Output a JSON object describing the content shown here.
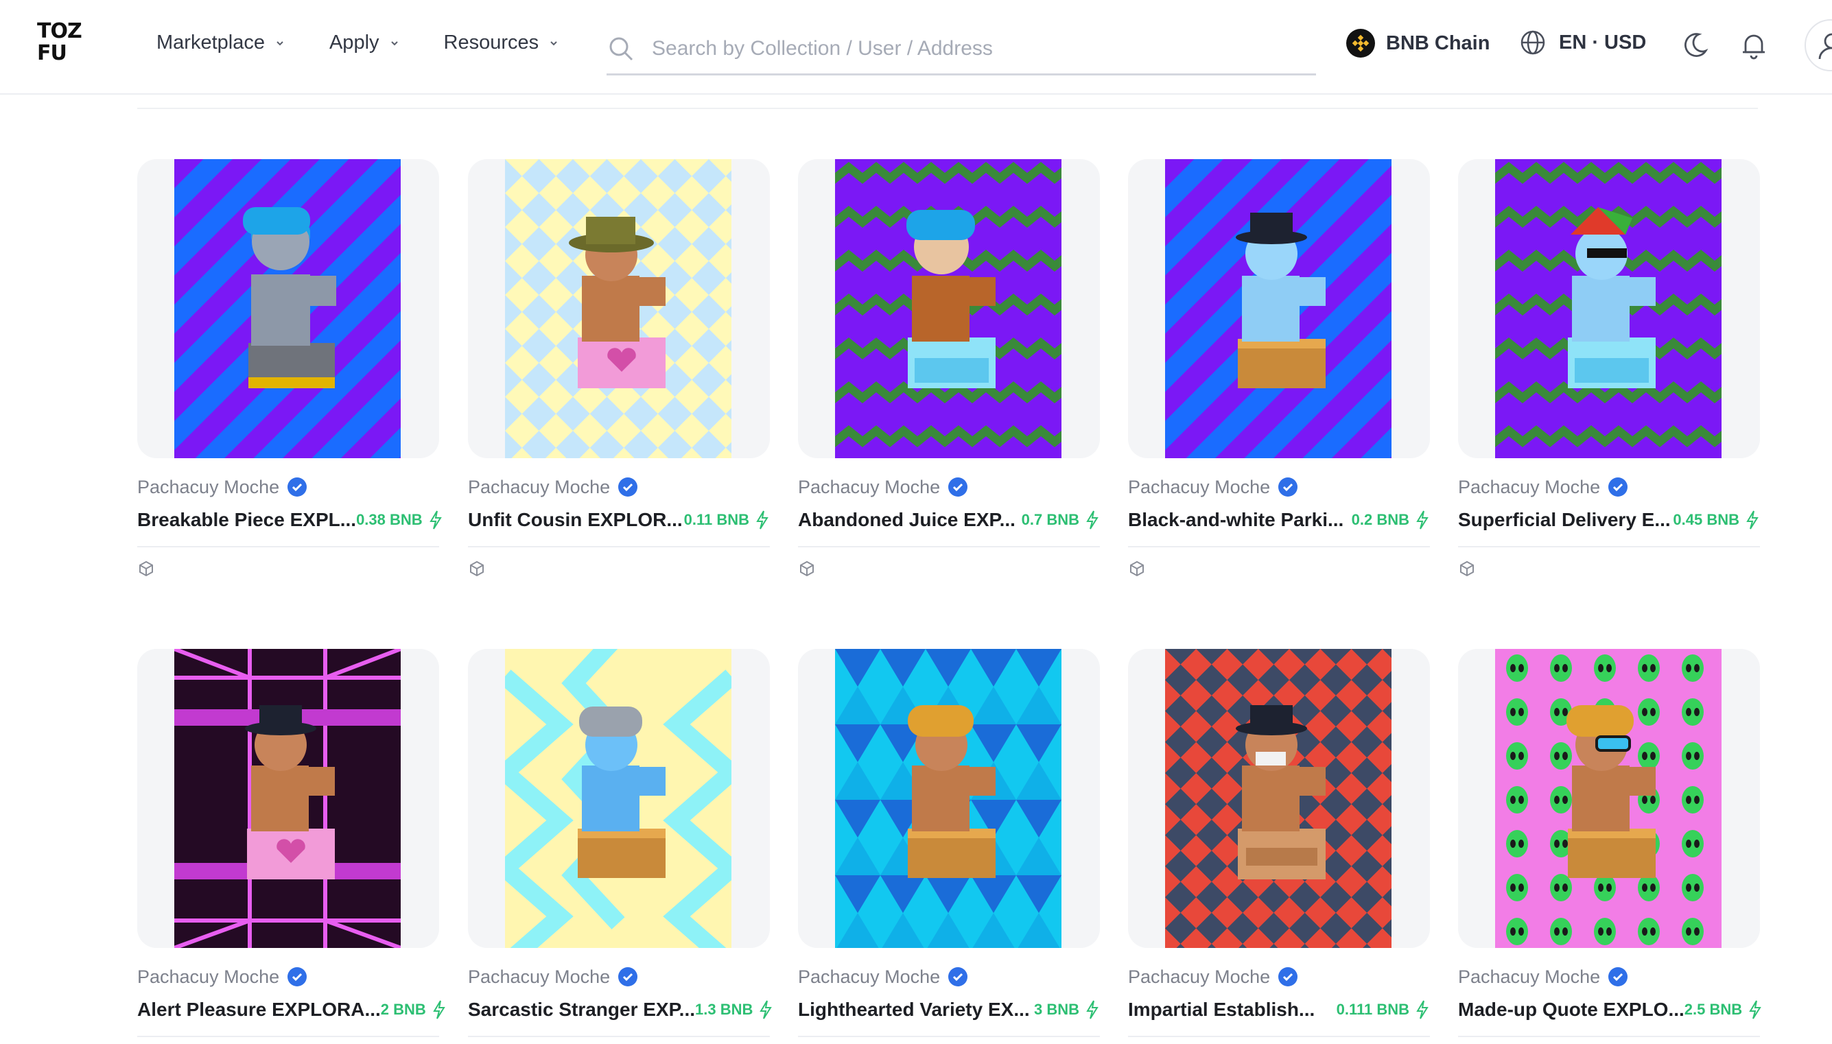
{
  "header": {
    "logo_line1": "TOZ",
    "logo_line2": "FU",
    "nav": [
      {
        "label": "Marketplace"
      },
      {
        "label": "Apply"
      },
      {
        "label": "Resources"
      }
    ],
    "search_placeholder": "Search by Collection / User / Address",
    "chain_label": "BNB Chain",
    "locale_label": "EN · USD"
  },
  "cards": [
    {
      "creator": "Pachacuy Moche",
      "name": "Breakable Piece EXPL...",
      "price": "0.38 BNB"
    },
    {
      "creator": "Pachacuy Moche",
      "name": "Unfit Cousin EXPLOR...",
      "price": "0.11 BNB"
    },
    {
      "creator": "Pachacuy Moche",
      "name": "Abandoned Juice EXP...",
      "price": "0.7 BNB"
    },
    {
      "creator": "Pachacuy Moche",
      "name": "Black-and-white Parki...",
      "price": "0.2 BNB"
    },
    {
      "creator": "Pachacuy Moche",
      "name": "Superficial Delivery E...",
      "price": "0.45 BNB"
    },
    {
      "creator": "Pachacuy Moche",
      "name": "Alert Pleasure EXPLORA...",
      "price": "2 BNB"
    },
    {
      "creator": "Pachacuy Moche",
      "name": "Sarcastic Stranger EXP...",
      "price": "1.3 BNB"
    },
    {
      "creator": "Pachacuy Moche",
      "name": "Lighthearted Variety EX...",
      "price": "3 BNB"
    },
    {
      "creator": "Pachacuy Moche",
      "name": "Impartial Establish...",
      "price": "0.111 BNB"
    },
    {
      "creator": "Pachacuy Moche",
      "name": "Made-up Quote EXPLO...",
      "price": "2.5 BNB"
    }
  ],
  "colors": {
    "price_green": "#2dbf73",
    "verified_blue": "#2f6fe8",
    "accent_purple": "#7b18f5",
    "accent_blue": "#1a6cff"
  }
}
